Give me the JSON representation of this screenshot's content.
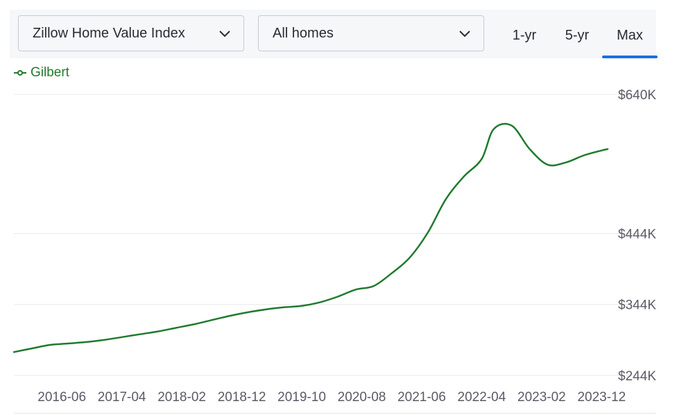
{
  "controls": {
    "metric_select": "Zillow Home Value Index",
    "home_type_select": "All homes",
    "range_tabs": [
      {
        "label": "1-yr",
        "active": false
      },
      {
        "label": "5-yr",
        "active": false
      },
      {
        "label": "Max",
        "active": true
      }
    ]
  },
  "icons": {
    "dropdown": "chevron-down-icon",
    "legend_marker": "line-with-circle-icon"
  },
  "colors": {
    "series_line": "#1f7a2e",
    "active_tab_underline": "#1a6ee8",
    "grid": "#e8e8e8"
  },
  "chart_data": {
    "type": "line",
    "title": "",
    "xlabel": "",
    "ylabel": "",
    "x_tick_labels": [
      "2016-06",
      "2017-04",
      "2018-02",
      "2018-12",
      "2019-10",
      "2020-08",
      "2021-06",
      "2022-04",
      "2023-02",
      "2023-12"
    ],
    "y_tick_labels": [
      "$640K",
      "$444K",
      "$344K",
      "$244K"
    ],
    "y_ticks": [
      640000,
      444000,
      344000,
      244000
    ],
    "xlim": [
      "2015-10",
      "2024-01"
    ],
    "ylim": [
      244000,
      640000
    ],
    "grid": true,
    "legend_position": "top-left",
    "series": [
      {
        "name": "Gilbert",
        "x": [
          "2015-10",
          "2016-01",
          "2016-04",
          "2016-07",
          "2016-10",
          "2017-01",
          "2017-04",
          "2017-07",
          "2017-10",
          "2018-01",
          "2018-04",
          "2018-07",
          "2018-10",
          "2019-01",
          "2019-04",
          "2019-07",
          "2019-10",
          "2020-01",
          "2020-04",
          "2020-07",
          "2020-10",
          "2021-01",
          "2021-04",
          "2021-07",
          "2021-10",
          "2022-01",
          "2022-04",
          "2022-06",
          "2022-09",
          "2022-12",
          "2023-03",
          "2023-06",
          "2023-09",
          "2023-12",
          "2024-01"
        ],
        "values": [
          277000,
          282000,
          287000,
          289000,
          291000,
          294000,
          298000,
          302000,
          306000,
          311000,
          316000,
          322000,
          328000,
          333000,
          337000,
          340000,
          342000,
          347000,
          355000,
          365000,
          370000,
          388000,
          410000,
          445000,
          492000,
          524000,
          549000,
          591000,
          596000,
          563000,
          541000,
          544000,
          554000,
          561000,
          563000
        ]
      }
    ]
  }
}
